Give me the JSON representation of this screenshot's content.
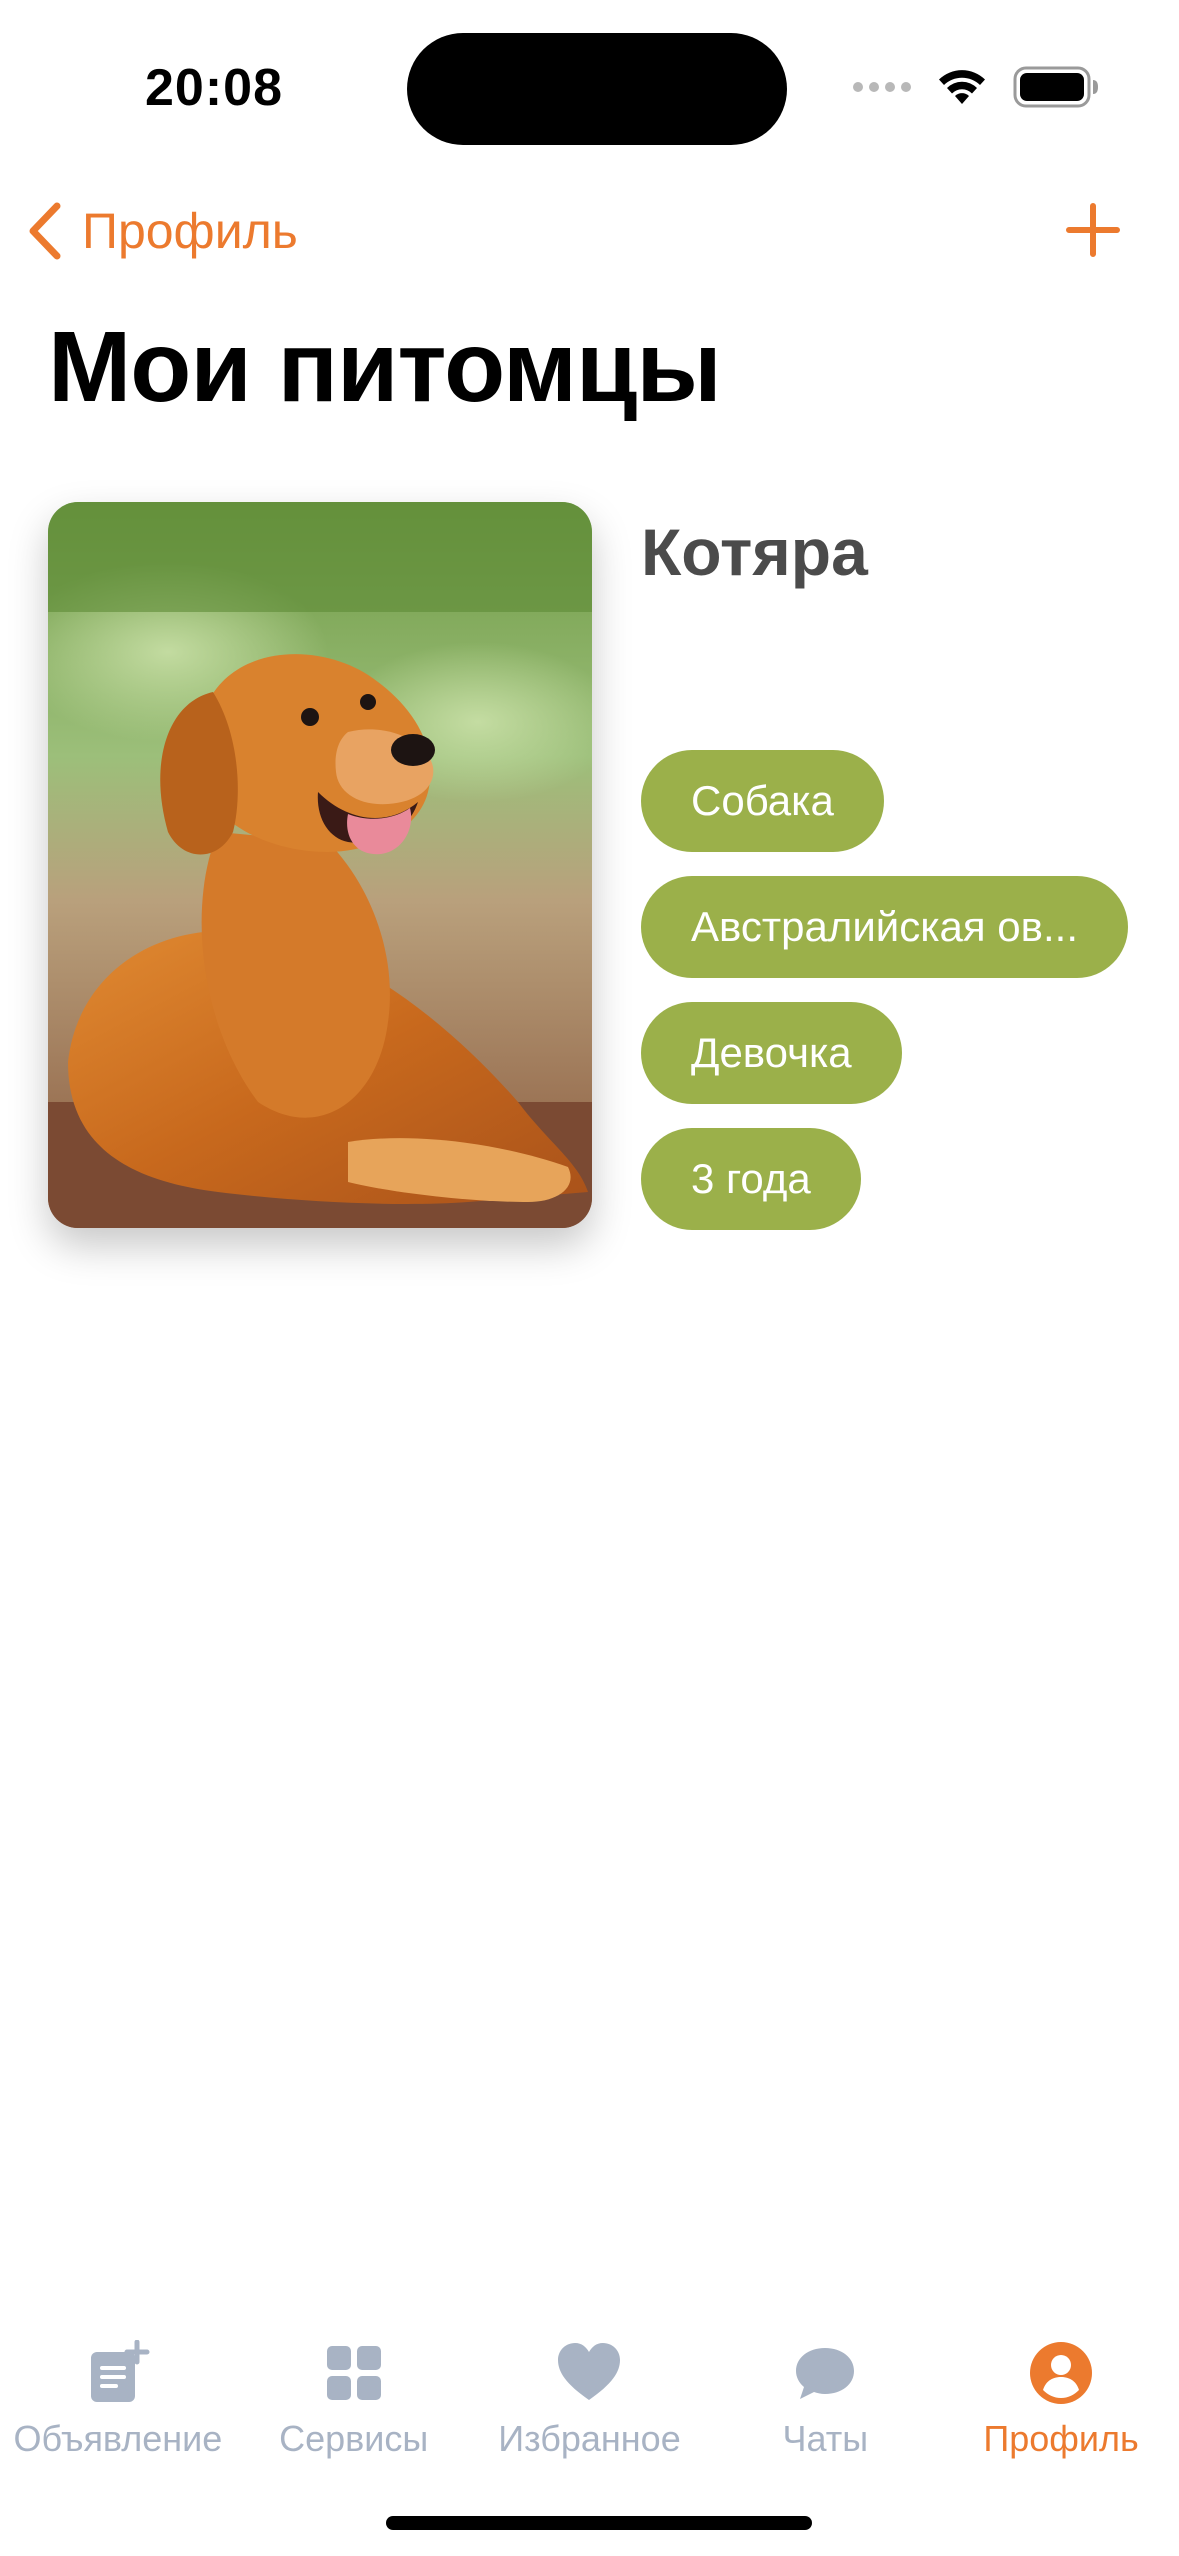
{
  "status_bar": {
    "time": "20:08"
  },
  "nav": {
    "back_label": "Профиль",
    "add_icon": "plus-icon",
    "back_icon": "chevron-left-icon"
  },
  "page": {
    "title": "Мои питомцы"
  },
  "pets": [
    {
      "name": "Котяра",
      "photo": "golden-retriever-photo",
      "tags": [
        "Собака",
        "Австралийская ов...",
        "Девочка",
        "3 года"
      ]
    }
  ],
  "tab_bar": {
    "items": [
      {
        "label": "Объявление",
        "icon": "add-listing-icon",
        "active": false
      },
      {
        "label": "Сервисы",
        "icon": "grid-icon",
        "active": false
      },
      {
        "label": "Избранное",
        "icon": "heart-icon",
        "active": false
      },
      {
        "label": "Чаты",
        "icon": "chat-bubble-icon",
        "active": false
      },
      {
        "label": "Профиль",
        "icon": "profile-icon",
        "active": true
      }
    ]
  },
  "colors": {
    "accent": "#ec7a2e",
    "tag_background": "#9bb04a",
    "tab_inactive": "#a8b3c4"
  }
}
